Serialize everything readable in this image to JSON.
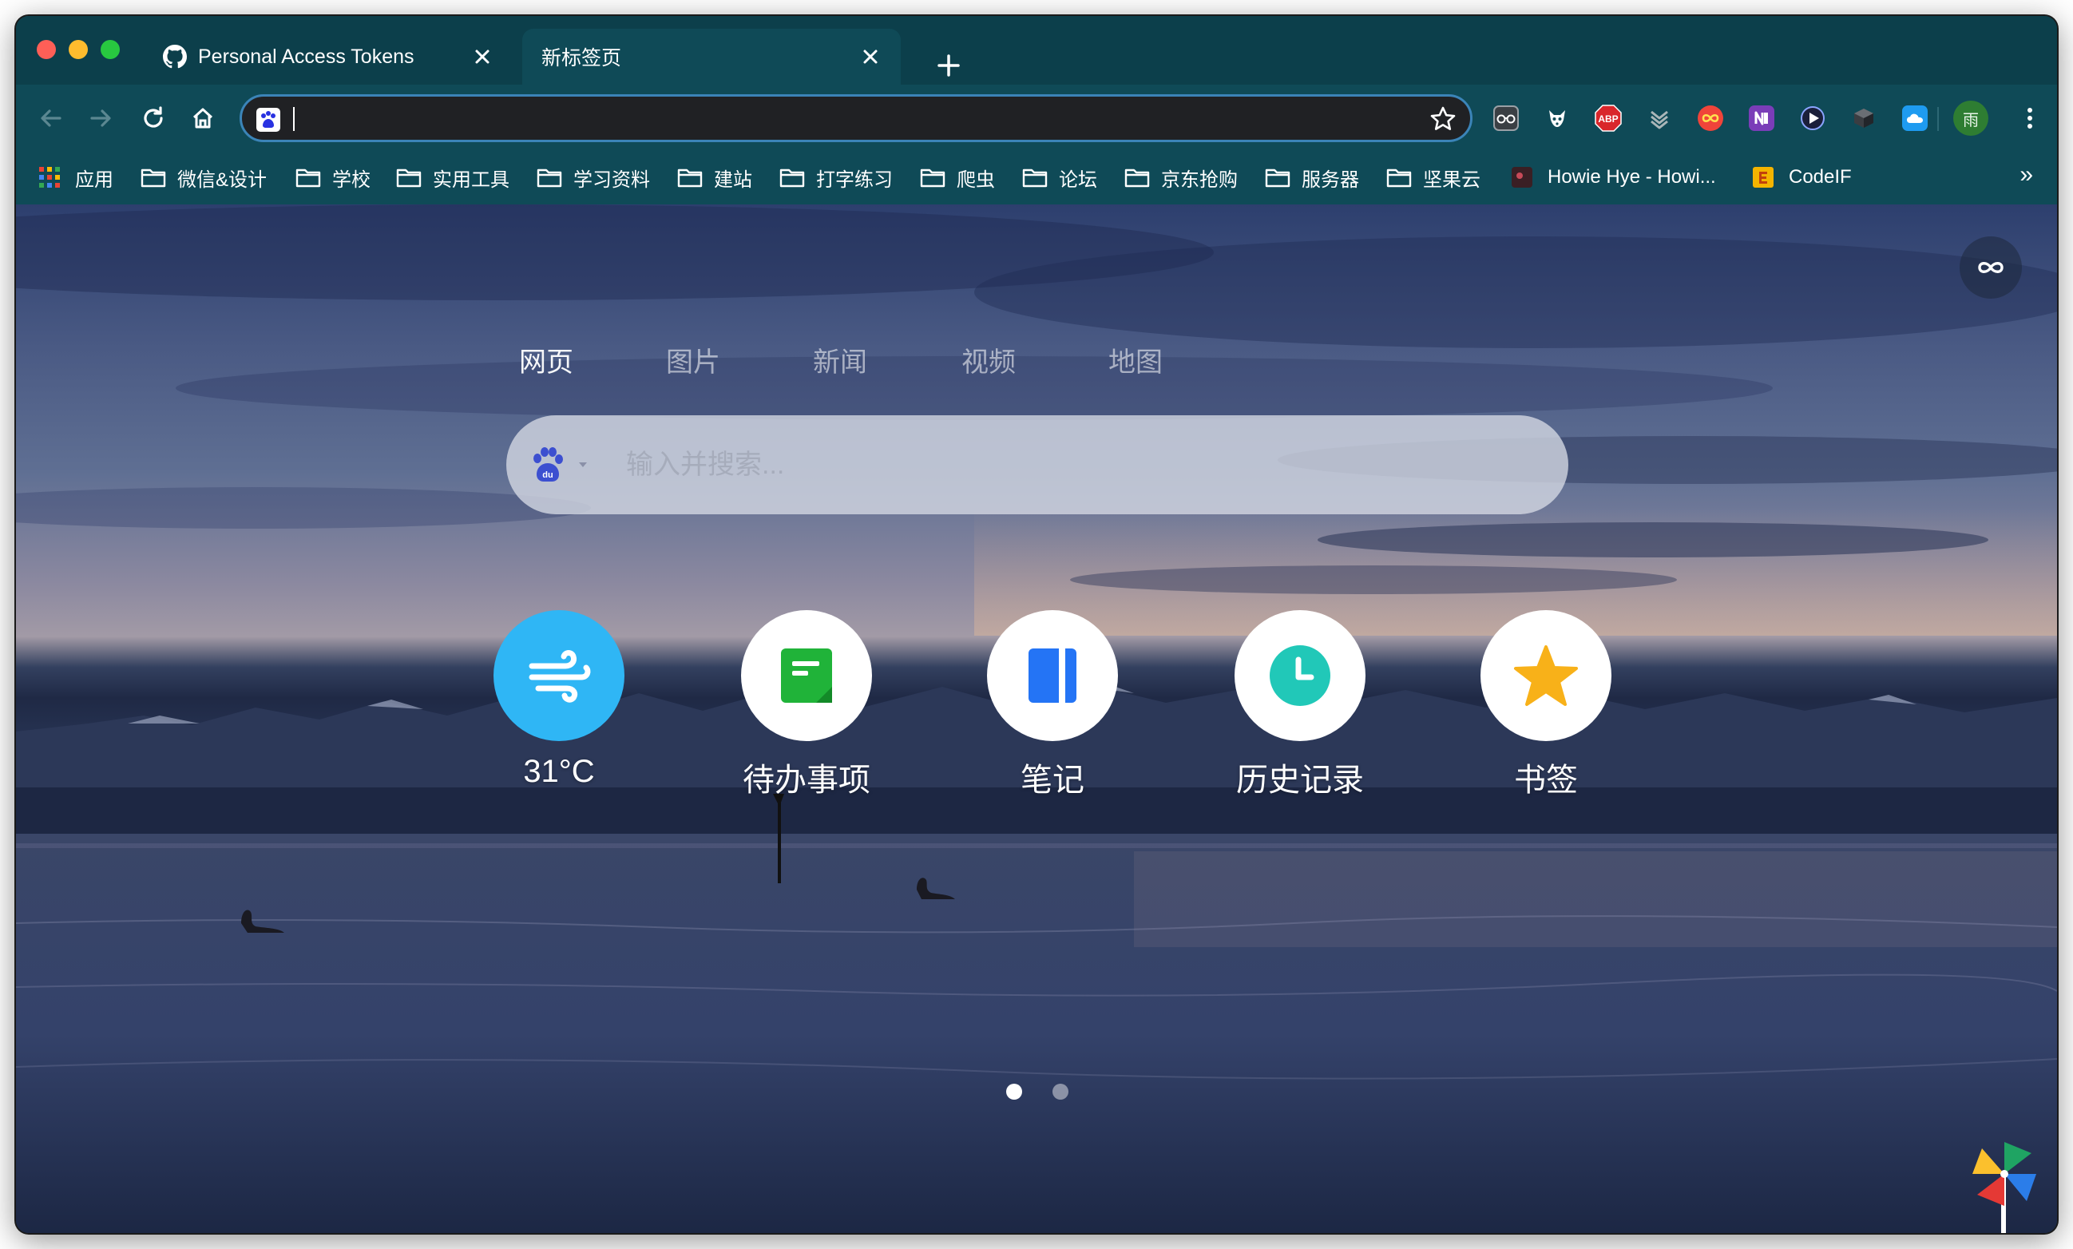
{
  "browser": {
    "tabs": [
      {
        "title": "Personal Access Tokens",
        "active": false
      },
      {
        "title": "新标签页",
        "active": true
      }
    ],
    "omnibox": {
      "value": ""
    }
  },
  "bookmarks": [
    {
      "label": "应用"
    },
    {
      "label": "微信&设计"
    },
    {
      "label": "学校"
    },
    {
      "label": "实用工具"
    },
    {
      "label": "学习资料"
    },
    {
      "label": "建站"
    },
    {
      "label": "打字练习"
    },
    {
      "label": "爬虫"
    },
    {
      "label": "论坛"
    },
    {
      "label": "京东抢购"
    },
    {
      "label": "服务器"
    },
    {
      "label": "坚果云"
    },
    {
      "label": "Howie Hye - Howi..."
    },
    {
      "label": "CodeIF"
    }
  ],
  "bookmarks_more": "»",
  "extensions": {
    "abp_label": "ABP",
    "profile_initial": "雨"
  },
  "newtab": {
    "search_tabs": [
      "网页",
      "图片",
      "新闻",
      "视频",
      "地图"
    ],
    "search_placeholder": "输入并搜索...",
    "shortcuts": [
      {
        "label": "31°C",
        "icon": "wind-icon",
        "color": "#2fb6f5"
      },
      {
        "label": "待办事项",
        "icon": "todo-icon",
        "color": "#20b339"
      },
      {
        "label": "笔记",
        "icon": "notes-icon",
        "color": "#2474f5"
      },
      {
        "label": "历史记录",
        "icon": "clock-icon",
        "color": "#21c8b8"
      },
      {
        "label": "书签",
        "icon": "star-icon",
        "color": "#f8b119"
      }
    ],
    "page_dots": 2,
    "active_page": 1
  },
  "colors": {
    "tabstrip": "#0c3f4b",
    "toolbar": "#0f4a57",
    "omnibox_border": "#3b84b8"
  }
}
